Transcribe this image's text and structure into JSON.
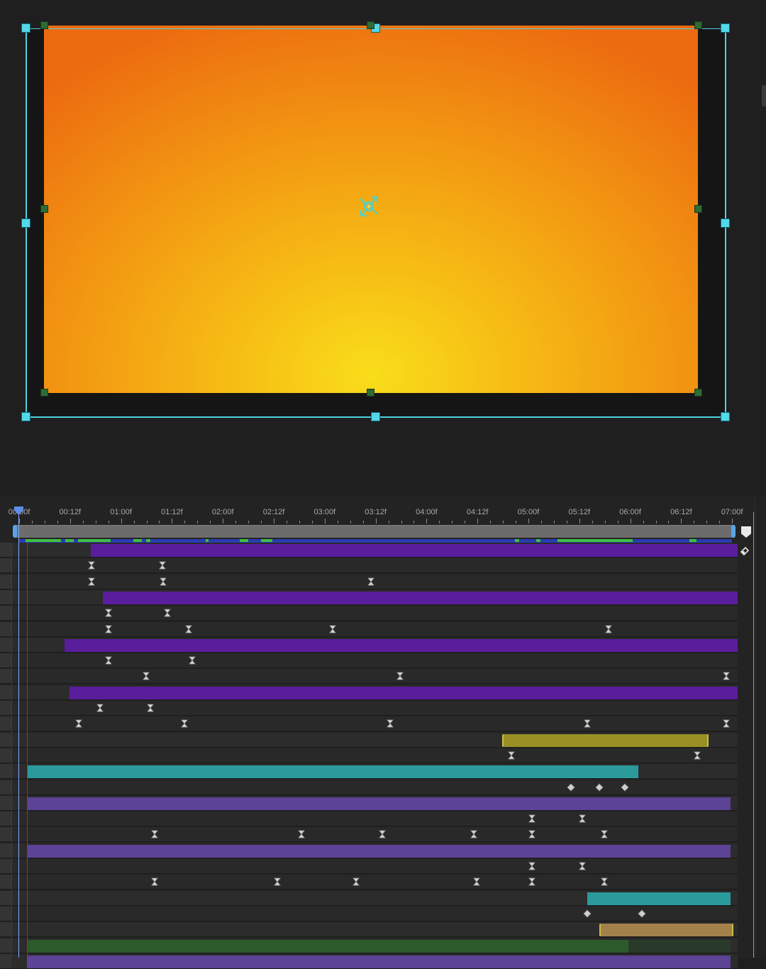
{
  "timeline": {
    "ruler_labels": [
      "00:00f",
      "00:12f",
      "01:00f",
      "01:12f",
      "02:00f",
      "02:12f",
      "03:00f",
      "03:12f",
      "04:00f",
      "04:12f",
      "05:00f",
      "05:12f",
      "06:00f",
      "06:12f",
      "07:00f"
    ]
  },
  "colors": {
    "purple_layer": "#5a1d9c",
    "lavender_layer": "#5d4396",
    "teal_layer": "#2a9a9d",
    "olive_layer": "#9a8f25",
    "tan_layer": "#a3814a",
    "green_layer": "#2d5a2a",
    "selection_handle": "#55d7ea",
    "layer_handle": "#2e6b36",
    "current_time_indicator": "#7fa8ff"
  },
  "icons": {
    "anchor": "anchor-point-icon",
    "keyframe_ease": "easy-ease-keyframe-icon",
    "keyframe_linear": "linear-keyframe-icon",
    "end_marker": "work-area-end-icon",
    "snap": "snapping-icon"
  }
}
